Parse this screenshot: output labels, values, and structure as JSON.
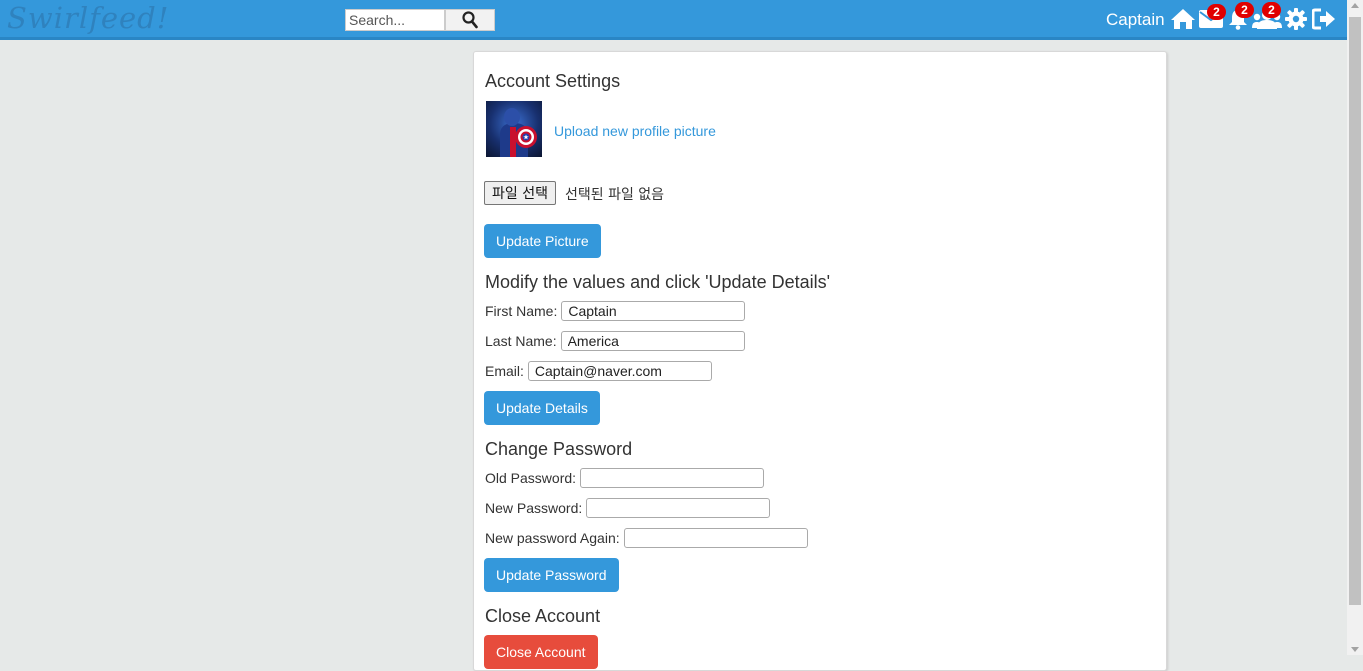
{
  "header": {
    "logo": "Swirlfeed!",
    "search_placeholder": "Search...",
    "username": "Captain",
    "badges": {
      "messages": "2",
      "notifications": "2",
      "friend_requests": "2"
    },
    "colors": {
      "bar": "#3498db",
      "badge": "#e00000"
    }
  },
  "settings": {
    "title": "Account Settings",
    "upload_link": "Upload new profile picture",
    "file_button": "파일 선택",
    "file_status": "선택된 파일 없음",
    "update_picture": "Update Picture"
  },
  "details": {
    "title": "Modify the values and click 'Update Details'",
    "first_name_label": "First Name:",
    "first_name": "Captain",
    "last_name_label": "Last Name:",
    "last_name": "America",
    "email_label": "Email:",
    "email": "Captain@naver.com",
    "submit": "Update Details"
  },
  "password": {
    "title": "Change Password",
    "old_label": "Old Password:",
    "new_label": "New Password:",
    "again_label": "New password Again:",
    "submit": "Update Password"
  },
  "close": {
    "title": "Close Account",
    "button": "Close Account",
    "color": "#e74c3c"
  }
}
